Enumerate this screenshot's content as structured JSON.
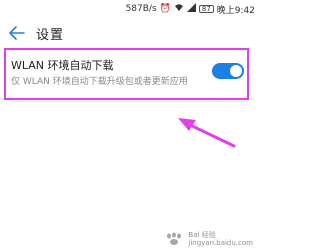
{
  "status_bar": {
    "network_speed": "587B/s",
    "alarm_icon": "alarm-icon",
    "wifi_icon": "wifi-icon",
    "signal_icon": "signal-icon",
    "battery_level": "87",
    "time": "晚上9:42"
  },
  "header": {
    "back_icon": "back-arrow-icon",
    "title": "设置"
  },
  "setting": {
    "title": "WLAN 环境自动下载",
    "subtitle": "仅 WLAN 环境自动下载升级包或者更新应用",
    "toggle_on": true
  },
  "colors": {
    "accent": "#1b7fe3",
    "highlight": "#e040e8"
  },
  "watermark": {
    "brand": "Bai 经验",
    "url": "jingyan.baidu.com"
  }
}
